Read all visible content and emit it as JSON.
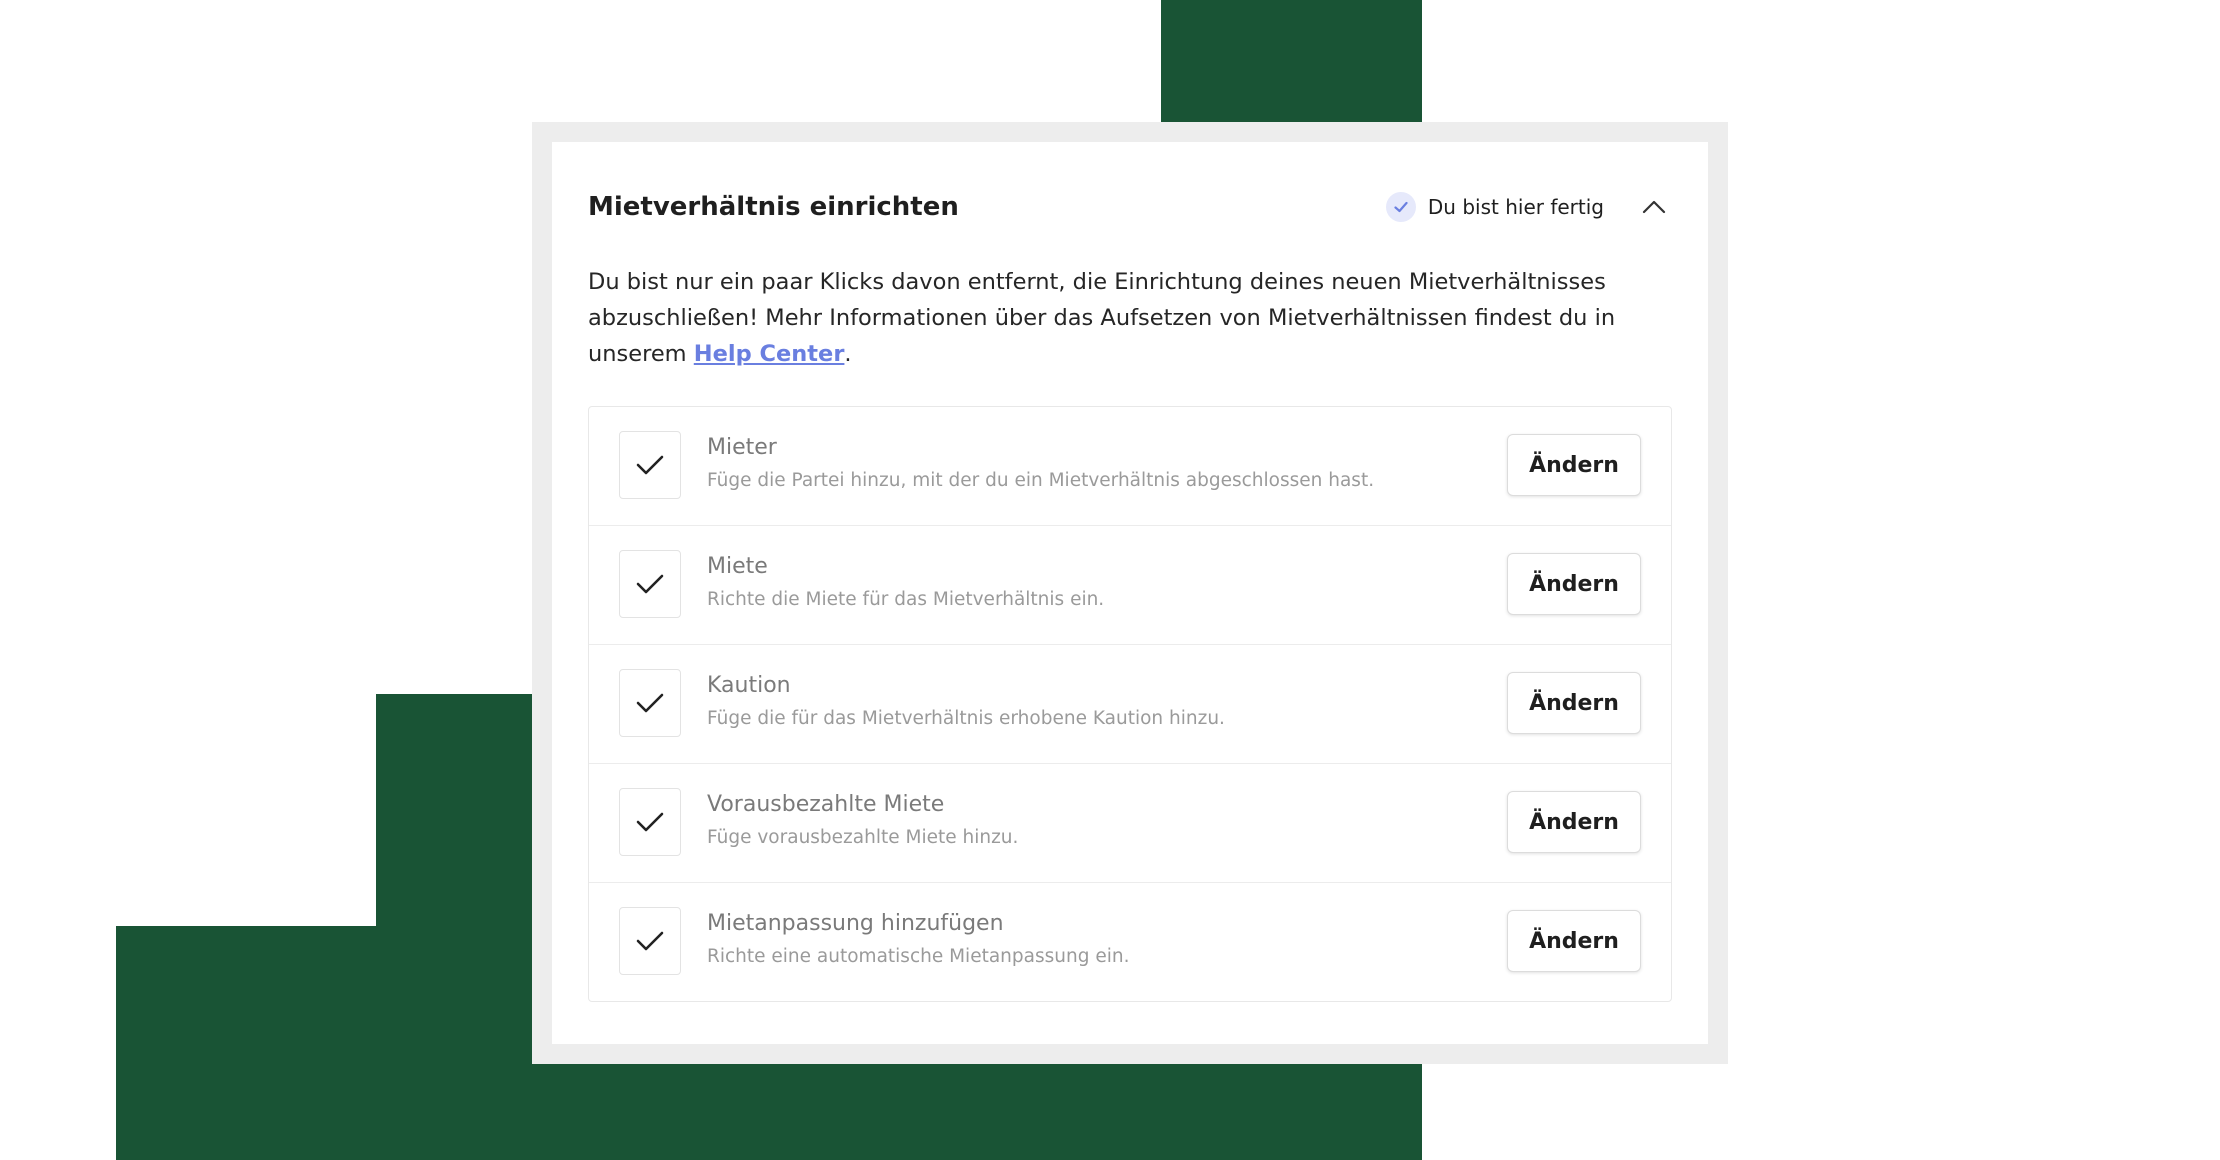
{
  "colors": {
    "green": "#195435",
    "accent": "#6a7fe0",
    "badge": "#e6e9fb"
  },
  "card": {
    "title": "Mietverhältnis einrichten",
    "status": {
      "icon": "check-icon",
      "text": "Du bist hier fertig"
    },
    "toggle_icon": "chevron-up-icon",
    "intro": {
      "text": "Du bist nur ein paar Klicks davon entfernt, die Einrichtung deines neuen Mietverhältnisses abzuschließen! Mehr Informationen über das Aufsetzen von Mietverhältnissen findest du in unserem ",
      "link": "Help Center",
      "suffix": "."
    }
  },
  "steps": [
    {
      "title": "Mieter",
      "description": "Füge die Partei hinzu, mit der du ein Mietverhältnis abgeschlossen hast.",
      "button": "Ändern",
      "done": true
    },
    {
      "title": "Miete",
      "description": "Richte die Miete für das Mietverhältnis ein.",
      "button": "Ändern",
      "done": true
    },
    {
      "title": "Kaution",
      "description": "Füge die für das Mietverhältnis erhobene Kaution hinzu.",
      "button": "Ändern",
      "done": true
    },
    {
      "title": "Vorausbezahlte Miete",
      "description": "Füge vorausbezahlte Miete hinzu.",
      "button": "Ändern",
      "done": true
    },
    {
      "title": "Mietanpassung hinzufügen",
      "description": "Richte eine automatische Mietanpassung ein.",
      "button": "Ändern",
      "done": true
    }
  ]
}
